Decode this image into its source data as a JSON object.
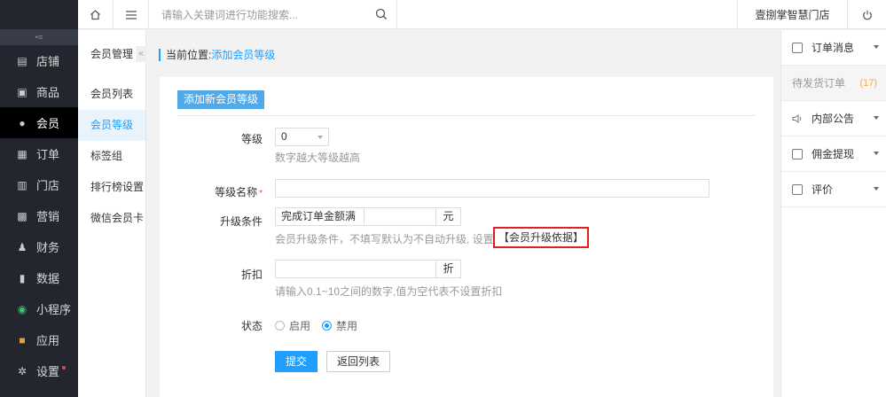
{
  "sidebar": {
    "items": [
      {
        "label": "店铺",
        "icon": "store-icon"
      },
      {
        "label": "商品",
        "icon": "goods-icon"
      },
      {
        "label": "会员",
        "icon": "member-icon"
      },
      {
        "label": "订单",
        "icon": "order-icon"
      },
      {
        "label": "门店",
        "icon": "shop-icon"
      },
      {
        "label": "营销",
        "icon": "marketing-icon"
      },
      {
        "label": "财务",
        "icon": "finance-icon"
      },
      {
        "label": "数据",
        "icon": "data-icon"
      },
      {
        "label": "小程序",
        "icon": "miniprogram-icon"
      },
      {
        "label": "应用",
        "icon": "apps-icon"
      },
      {
        "label": "设置",
        "icon": "settings-icon"
      }
    ]
  },
  "topbar": {
    "search_placeholder": "请输入关键词进行功能搜索...",
    "store_name": "壹捌掌智慧门店"
  },
  "submenu": {
    "title": "会员管理",
    "items": [
      "会员列表",
      "会员等级",
      "标签组",
      "排行榜设置",
      "微信会员卡"
    ]
  },
  "breadcrumb": {
    "prefix": "当前位置:",
    "current": "添加会员等级"
  },
  "form": {
    "tab_label": "添加新会员等级",
    "level_label": "等级",
    "level_value": "0",
    "level_hint": "数字越大等级越高",
    "name_label": "等级名称",
    "name_required_mark": "*",
    "name_value": "",
    "upgrade_label": "升级条件",
    "upgrade_type": "完成订单金额满",
    "upgrade_value": "",
    "upgrade_unit": "元",
    "upgrade_hint": "会员升级条件，不填写默认为不自动升级, 设置",
    "upgrade_link": "【会员升级依据】",
    "discount_label": "折扣",
    "discount_value": "",
    "discount_unit": "折",
    "discount_hint": "请输入0.1~10之间的数字,值为空代表不设置折扣",
    "status_label": "状态",
    "status_options": [
      "启用",
      "禁用"
    ],
    "status_selected": "禁用",
    "submit_label": "提交",
    "back_label": "返回列表"
  },
  "rightpanel": {
    "order_msg": "订单消息",
    "pending_orders": "待发货订单",
    "pending_count": "(17)",
    "notice": "内部公告",
    "commission": "佣金提现",
    "review": "评价"
  },
  "colors": {
    "accent": "#1e9fff",
    "sidebar_bg": "#23262e",
    "highlight_border": "#e02020"
  }
}
